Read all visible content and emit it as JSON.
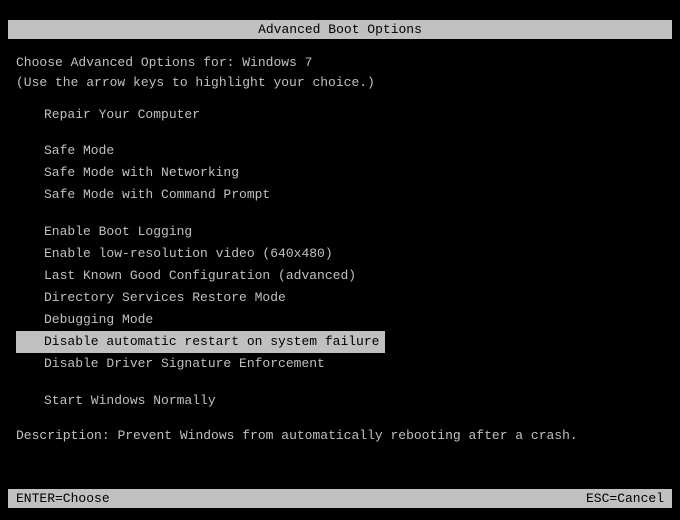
{
  "title": "Advanced Boot Options",
  "instruction_line1": "Choose Advanced Options for: Windows 7",
  "instruction_line2": "(Use the arrow keys to highlight your choice.)",
  "menu": {
    "group1": [
      {
        "label": "Repair Your Computer",
        "selected": false
      }
    ],
    "group2": [
      {
        "label": "Safe Mode",
        "selected": false
      },
      {
        "label": "Safe Mode with Networking",
        "selected": false
      },
      {
        "label": "Safe Mode with Command Prompt",
        "selected": false
      }
    ],
    "group3": [
      {
        "label": "Enable Boot Logging",
        "selected": false
      },
      {
        "label": "Enable low-resolution video (640x480)",
        "selected": false
      },
      {
        "label": "Last Known Good Configuration (advanced)",
        "selected": false
      },
      {
        "label": "Directory Services Restore Mode",
        "selected": false
      },
      {
        "label": "Debugging Mode",
        "selected": false
      },
      {
        "label": "Disable automatic restart on system failure",
        "selected": true
      },
      {
        "label": "Disable Driver Signature Enforcement",
        "selected": false
      }
    ],
    "group4": [
      {
        "label": "Start Windows Normally",
        "selected": false
      }
    ]
  },
  "description_label": "Description:",
  "description_text": "Prevent Windows from automatically rebooting after a crash.",
  "footer": {
    "enter": "ENTER=Choose",
    "esc": "ESC=Cancel"
  }
}
